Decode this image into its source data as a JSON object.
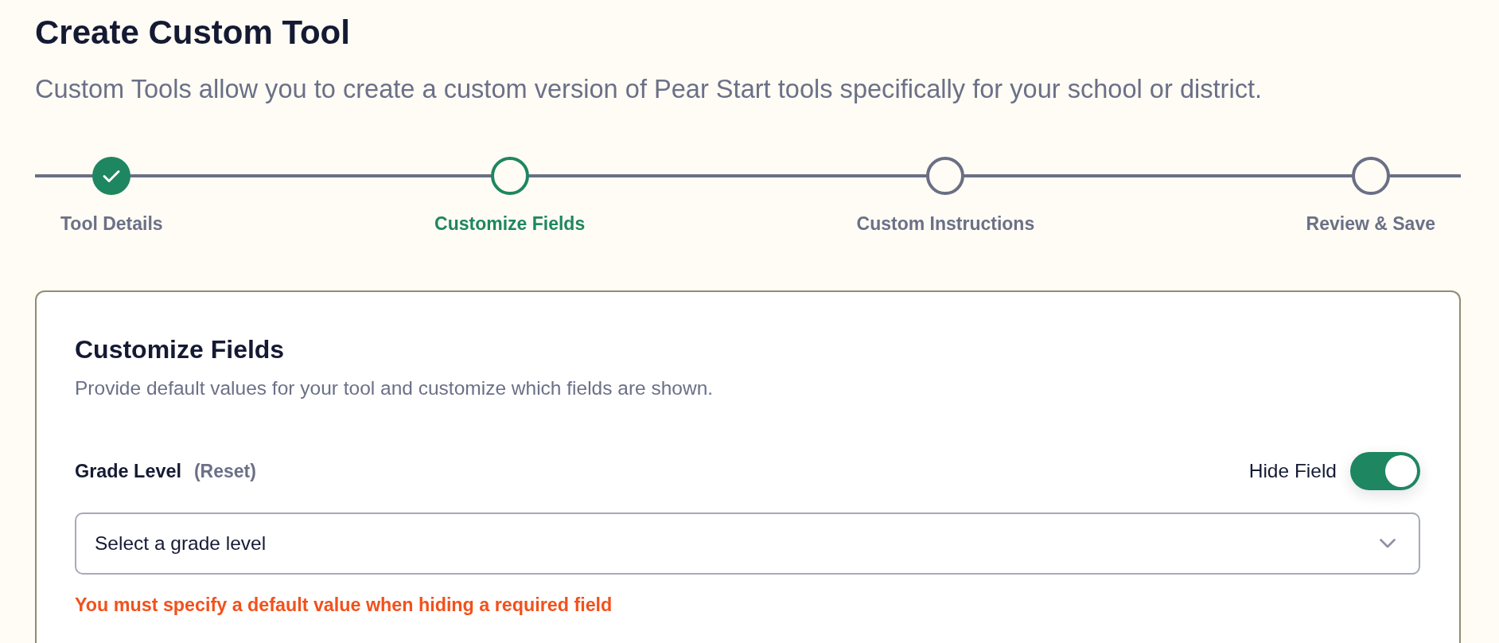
{
  "page": {
    "title": "Create Custom Tool",
    "description": "Custom Tools allow you to create a custom version of Pear Start tools specifically for your school or district."
  },
  "stepper": {
    "steps": [
      {
        "label": "Tool Details",
        "completed": true,
        "selected": false
      },
      {
        "label": "Customize Fields",
        "completed": false,
        "selected": true
      },
      {
        "label": "Custom Instructions",
        "completed": false,
        "selected": false
      },
      {
        "label": "Review & Save",
        "completed": false,
        "selected": false
      }
    ]
  },
  "card": {
    "title": "Customize Fields",
    "description": "Provide default values for your tool and customize which fields are shown.",
    "fields": [
      {
        "label": "Grade Level",
        "reset": "(Reset)",
        "toggle": {
          "label": "Hide Field",
          "on": true
        },
        "select": {
          "placeholder": "Select a grade level"
        },
        "error": "You must specify a default value when hiding a required field"
      }
    ]
  }
}
